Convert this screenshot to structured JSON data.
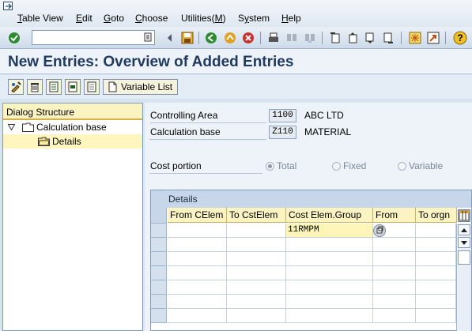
{
  "menu": {
    "items": [
      {
        "pre": "",
        "u": "T",
        "post": "able View"
      },
      {
        "pre": "",
        "u": "E",
        "post": "dit"
      },
      {
        "pre": "",
        "u": "G",
        "post": "oto"
      },
      {
        "pre": "",
        "u": "C",
        "post": "hoose"
      },
      {
        "pre": "Utilities(",
        "u": "M",
        "post": ")"
      },
      {
        "pre": "S",
        "u": "y",
        "post": "stem"
      },
      {
        "pre": "",
        "u": "H",
        "post": "elp"
      }
    ]
  },
  "command_field": {
    "value": ""
  },
  "title": "New Entries: Overview of Added Entries",
  "app_toolbar": {
    "variable_list_label": "Variable List"
  },
  "dialog_structure": {
    "header": "Dialog Structure",
    "items": [
      {
        "label": "Calculation base"
      },
      {
        "label": "Details"
      }
    ]
  },
  "fields": {
    "controlling_area": {
      "label": "Controlling Area",
      "value": "1100",
      "text": "ABC LTD"
    },
    "calculation_base": {
      "label": "Calculation base",
      "value": "Z110",
      "text": "MATERIAL"
    },
    "cost_portion": {
      "label": "Cost portion",
      "options": [
        "Total",
        "Fixed",
        "Variable"
      ],
      "selected": "Total"
    }
  },
  "details": {
    "title": "Details",
    "columns": [
      "From CElem",
      "To CstElem",
      "Cost Elem.Group",
      "From",
      "To orgn"
    ],
    "rows": [
      [
        "",
        "",
        "11RMPM",
        "",
        ""
      ],
      [
        "",
        "",
        "",
        "",
        ""
      ],
      [
        "",
        "",
        "",
        "",
        ""
      ],
      [
        "",
        "",
        "",
        "",
        ""
      ],
      [
        "",
        "",
        "",
        "",
        ""
      ],
      [
        "",
        "",
        "",
        "",
        ""
      ],
      [
        "",
        "",
        "",
        "",
        ""
      ]
    ]
  },
  "colors": {
    "title": "#203a5f",
    "header_yellow": "#fbf3c2",
    "background": "#d9e4f1"
  }
}
